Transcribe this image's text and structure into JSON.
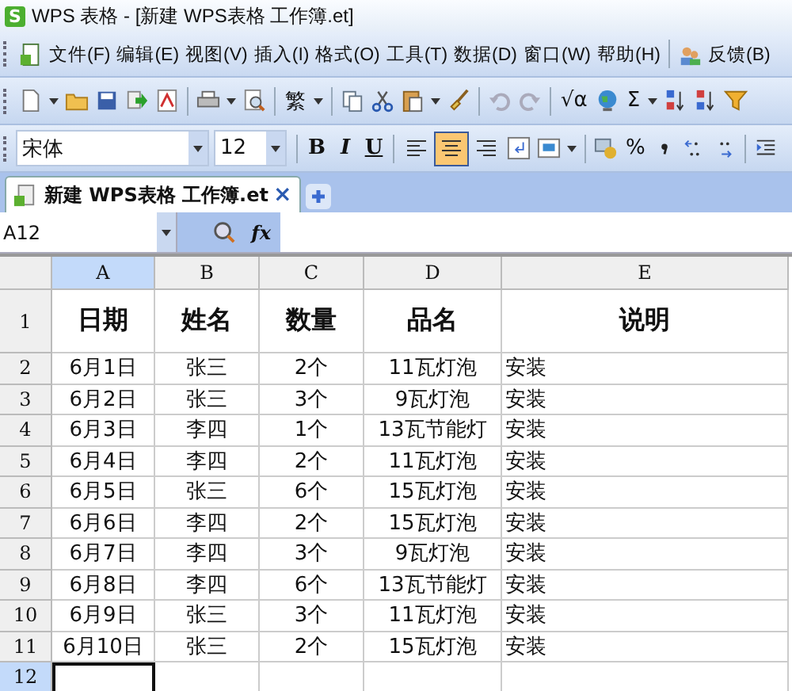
{
  "window": {
    "app_icon": "S",
    "title": "WPS 表格 - [新建 WPS表格 工作簿.et]"
  },
  "menu": [
    "文件(F)",
    "编辑(E)",
    "视图(V)",
    "插入(I)",
    "格式(O)",
    "工具(T)",
    "数据(D)",
    "窗口(W)",
    "帮助(H)"
  ],
  "feedback": "反馈(B)",
  "standard_toolbar": {
    "traditional": "繁",
    "formula": "√α",
    "sum": "Σ"
  },
  "format_toolbar": {
    "font": "宋体",
    "size": "12",
    "styles": [
      "B",
      "I",
      "U"
    ],
    "align": [
      {
        "selected": false
      },
      {
        "selected": true
      },
      {
        "selected": false
      }
    ],
    "percent": "%"
  },
  "tabs": [
    {
      "label": "新建 WPS表格 工作簿.et",
      "selected": true,
      "close": "×"
    }
  ],
  "formula_bar": {
    "name_box": "A12",
    "fx": "fx"
  },
  "sheet": {
    "columns": [
      {
        "label": "A",
        "selected": true
      },
      {
        "label": "B",
        "selected": false
      },
      {
        "label": "C",
        "selected": false
      },
      {
        "label": "D",
        "selected": false
      },
      {
        "label": "E",
        "selected": false
      }
    ],
    "rows": [
      {
        "number": "1",
        "kind": "header",
        "selected": false,
        "cells": [
          "日期",
          "姓名",
          "数量",
          "品名",
          "说明"
        ]
      },
      {
        "number": "2",
        "kind": "data",
        "selected": false,
        "cells": [
          "6月1日",
          "张三",
          "2个",
          "11瓦灯泡",
          "安装"
        ]
      },
      {
        "number": "3",
        "kind": "data",
        "selected": false,
        "cells": [
          "6月2日",
          "张三",
          "3个",
          "9瓦灯泡",
          "安装"
        ]
      },
      {
        "number": "4",
        "kind": "data",
        "selected": false,
        "cells": [
          "6月3日",
          "李四",
          "1个",
          "13瓦节能灯",
          "安装"
        ]
      },
      {
        "number": "5",
        "kind": "data",
        "selected": false,
        "cells": [
          "6月4日",
          "李四",
          "2个",
          "11瓦灯泡",
          "安装"
        ]
      },
      {
        "number": "6",
        "kind": "data",
        "selected": false,
        "cells": [
          "6月5日",
          "张三",
          "6个",
          "15瓦灯泡",
          "安装"
        ]
      },
      {
        "number": "7",
        "kind": "data",
        "selected": false,
        "cells": [
          "6月6日",
          "李四",
          "2个",
          "15瓦灯泡",
          "安装"
        ]
      },
      {
        "number": "8",
        "kind": "data",
        "selected": false,
        "cells": [
          "6月7日",
          "李四",
          "3个",
          "9瓦灯泡",
          "安装"
        ]
      },
      {
        "number": "9",
        "kind": "data",
        "selected": false,
        "cells": [
          "6月8日",
          "李四",
          "6个",
          "13瓦节能灯",
          "安装"
        ]
      },
      {
        "number": "10",
        "kind": "data",
        "selected": false,
        "cells": [
          "6月9日",
          "张三",
          "3个",
          "11瓦灯泡",
          "安装"
        ]
      },
      {
        "number": "11",
        "kind": "data",
        "selected": false,
        "cells": [
          "6月10日",
          "张三",
          "2个",
          "15瓦灯泡",
          "安装"
        ]
      },
      {
        "number": "12",
        "kind": "data",
        "selected": true,
        "cells": []
      }
    ]
  }
}
